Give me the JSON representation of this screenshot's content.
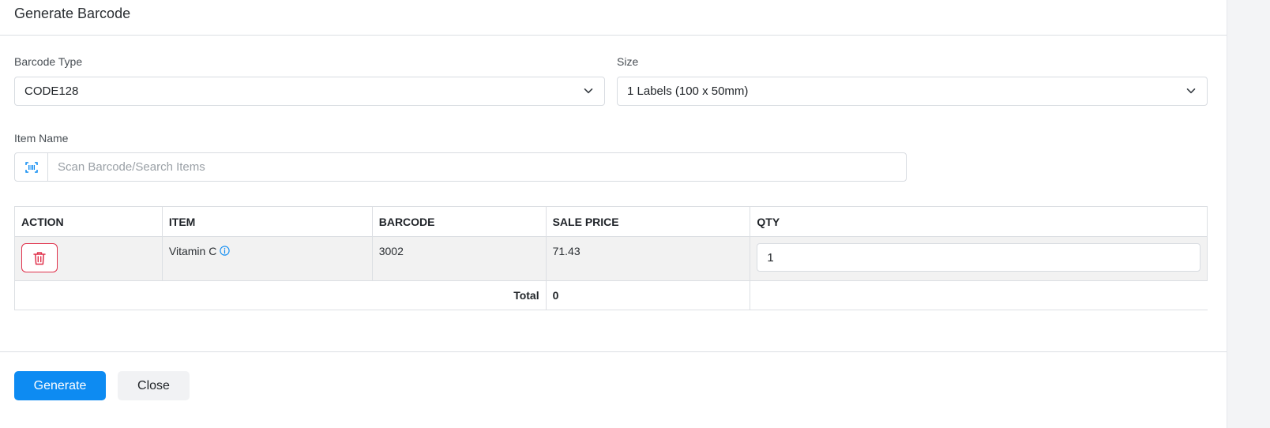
{
  "modal": {
    "title": "Generate Barcode"
  },
  "form": {
    "barcode_type": {
      "label": "Barcode Type",
      "value": "CODE128"
    },
    "size": {
      "label": "Size",
      "value": "1 Labels (100 x 50mm)"
    },
    "item_name": {
      "label": "Item Name",
      "placeholder": "Scan Barcode/Search Items",
      "value": ""
    }
  },
  "table": {
    "headers": {
      "action": "ACTION",
      "item": "ITEM",
      "barcode": "BARCODE",
      "sale_price": "SALE PRICE",
      "qty": "QTY"
    },
    "rows": [
      {
        "item": "Vitamin C",
        "barcode": "3002",
        "sale_price": "71.43",
        "qty": "1"
      }
    ],
    "total_label": "Total",
    "total_value": "0"
  },
  "footer": {
    "generate_label": "Generate",
    "close_label": "Close"
  },
  "colors": {
    "primary": "#0d8bf2",
    "danger": "#e0304a",
    "icon_blue": "#0d8bf2"
  },
  "icons": {
    "addon": "barcode-scan-icon",
    "delete": "trash-icon",
    "info": "info-circle-icon",
    "select": "chevron-down-icon"
  }
}
